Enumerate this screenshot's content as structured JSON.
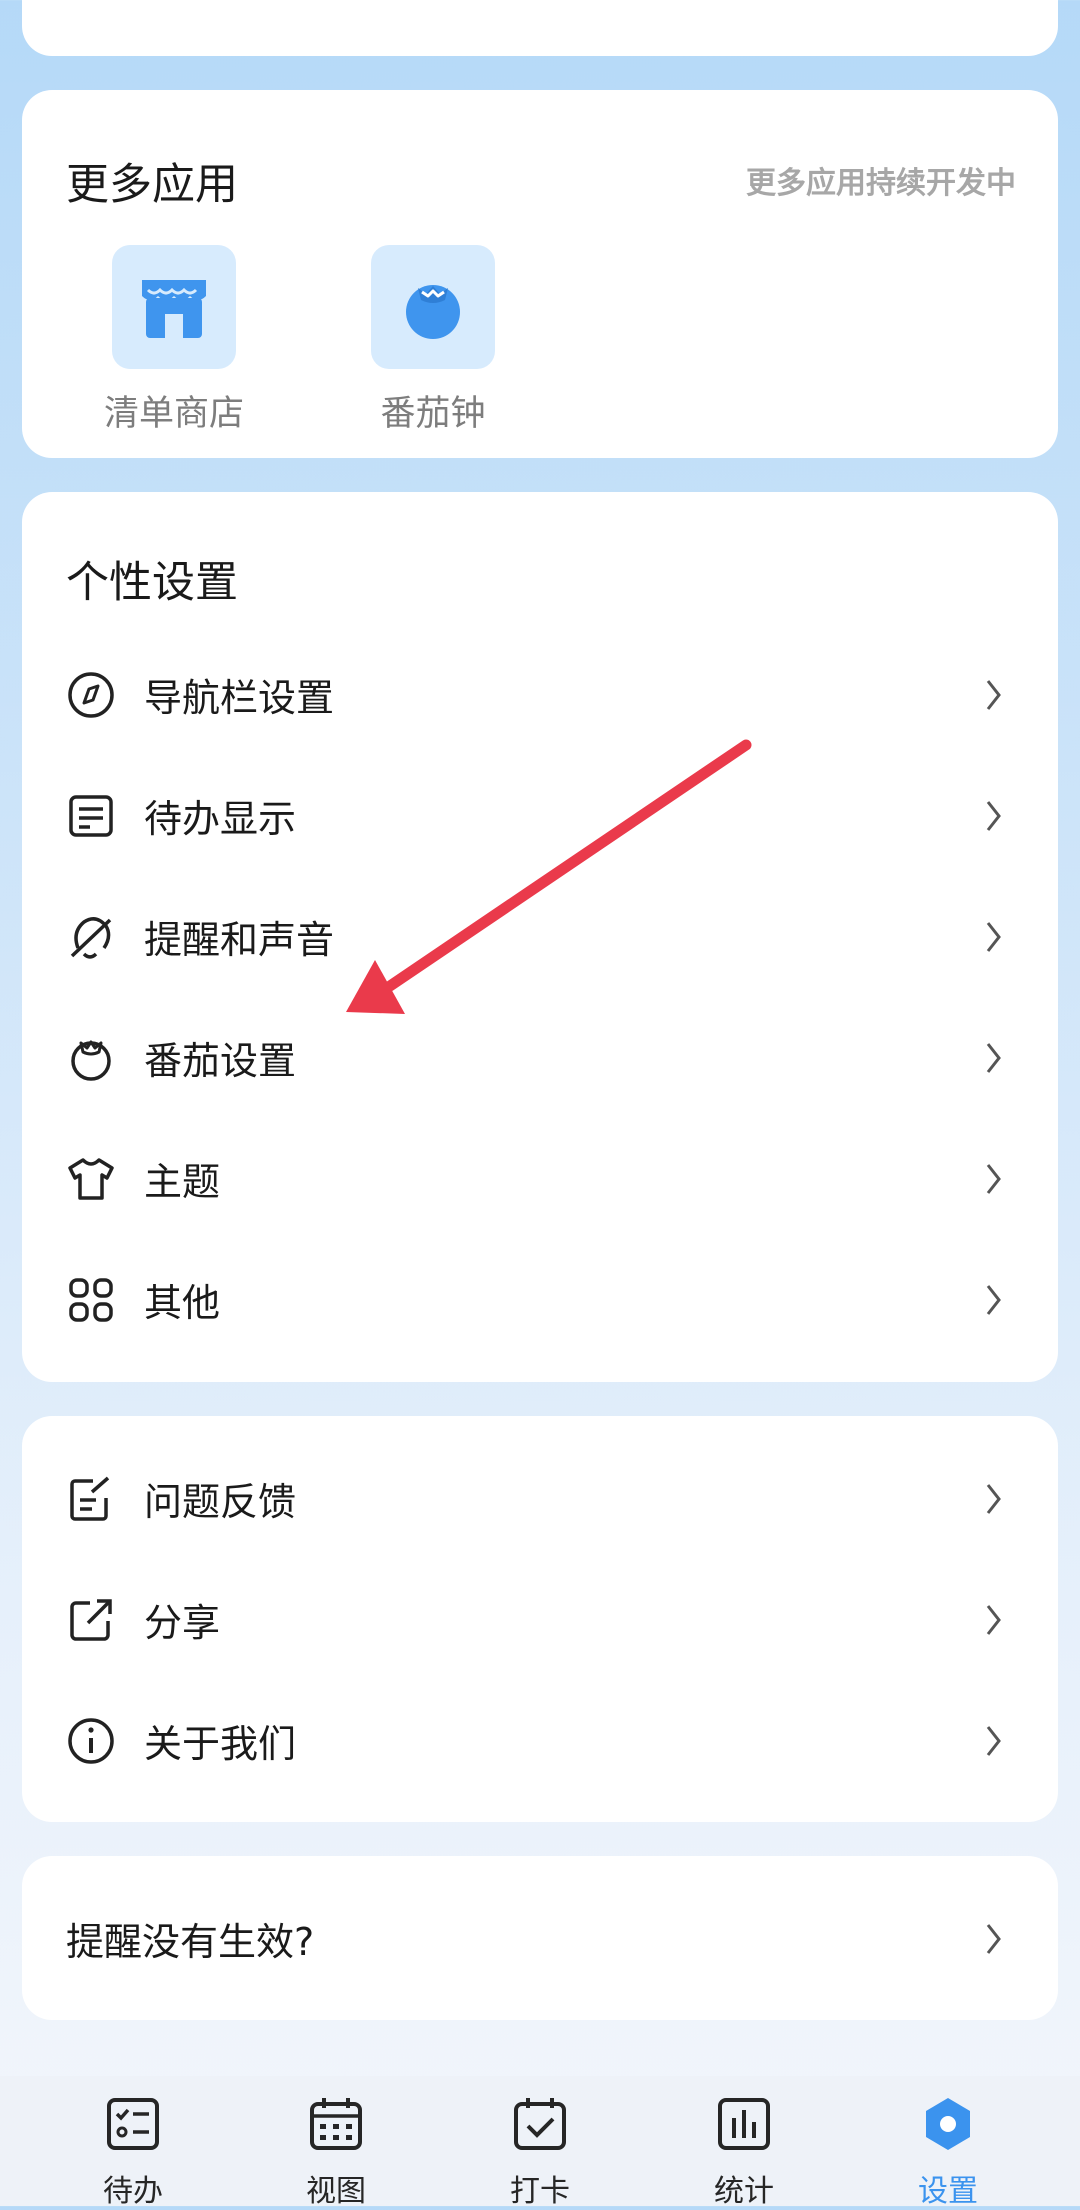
{
  "apps": {
    "title": "更多应用",
    "subtitle": "更多应用持续开发中",
    "items": [
      {
        "label": "清单商店",
        "icon": "store-icon"
      },
      {
        "label": "番茄钟",
        "icon": "tomato-icon"
      }
    ]
  },
  "settings": {
    "title": "个性设置",
    "items": [
      {
        "label": "导航栏设置",
        "icon": "compass-icon"
      },
      {
        "label": "待办显示",
        "icon": "list-icon"
      },
      {
        "label": "提醒和声音",
        "icon": "bell-off-icon"
      },
      {
        "label": "番茄设置",
        "icon": "tomato-outline-icon"
      },
      {
        "label": "主题",
        "icon": "shirt-icon"
      },
      {
        "label": "其他",
        "icon": "grid-icon"
      }
    ]
  },
  "misc": {
    "items": [
      {
        "label": "问题反馈",
        "icon": "feedback-icon"
      },
      {
        "label": "分享",
        "icon": "share-icon"
      },
      {
        "label": "关于我们",
        "icon": "info-icon"
      }
    ]
  },
  "help": {
    "label": "提醒没有生效?"
  },
  "tabbar": {
    "items": [
      {
        "label": "待办",
        "icon": "checklist-icon"
      },
      {
        "label": "视图",
        "icon": "calendar-icon"
      },
      {
        "label": "打卡",
        "icon": "calendar-check-icon"
      },
      {
        "label": "统计",
        "icon": "bar-chart-icon"
      },
      {
        "label": "设置",
        "icon": "settings-icon",
        "active": true
      }
    ]
  },
  "colors": {
    "accent": "#3b93ee",
    "annotation_arrow": "#ea3a4b",
    "icon_bg": "#d7ebfd"
  }
}
